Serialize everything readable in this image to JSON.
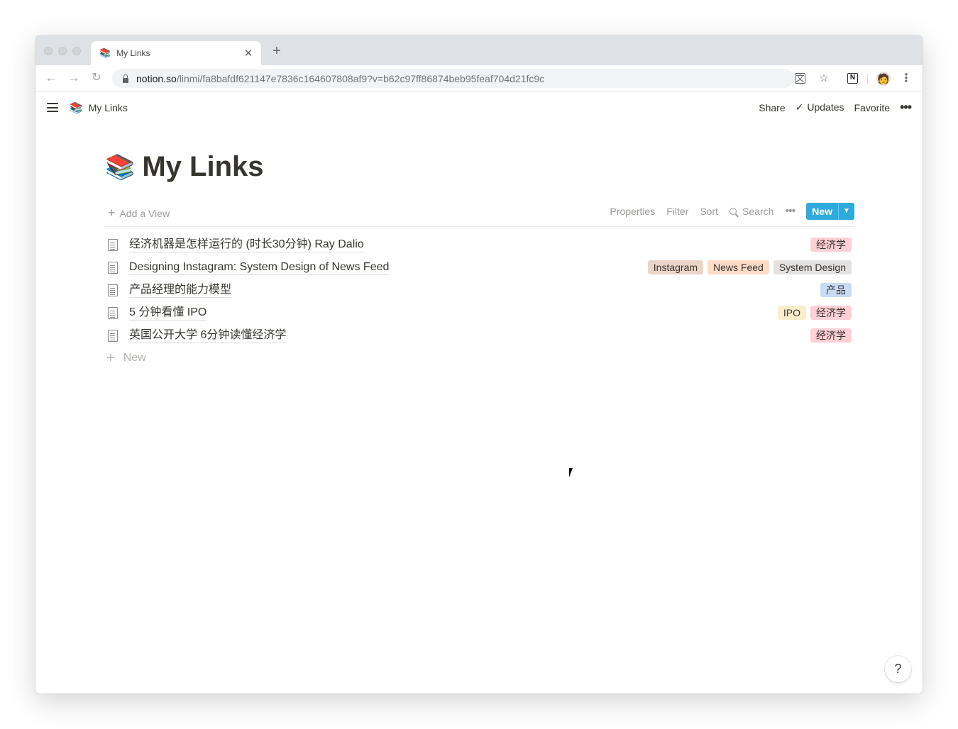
{
  "browser": {
    "tab_title": "My Links",
    "tab_icon": "books-emoji",
    "url_host": "notion.so",
    "url_path": "/linmi/fa8bafdf621147e7836c164607808af9?v=b62c97ff86874beb95feaf704d21fc9c"
  },
  "topbar": {
    "breadcrumb_emoji": "📚",
    "breadcrumb": "My Links",
    "share": "Share",
    "updates": "Updates",
    "favorite": "Favorite"
  },
  "page": {
    "emoji": "📚",
    "title": "My Links"
  },
  "viewbar": {
    "add_view": "Add a View",
    "properties": "Properties",
    "filter": "Filter",
    "sort": "Sort",
    "search": "Search",
    "new": "New"
  },
  "rows": [
    {
      "title": "经济机器是怎样运行的 (时长30分钟) Ray Dalio",
      "tags": [
        {
          "label": "经济学",
          "color": "#ffd0d6"
        }
      ]
    },
    {
      "title": "Designing Instagram: System Design of News Feed",
      "tags": [
        {
          "label": "Instagram",
          "color": "#ecd4c8"
        },
        {
          "label": "News Feed",
          "color": "#fddbc7"
        },
        {
          "label": "System Design",
          "color": "#e3e2e0"
        }
      ]
    },
    {
      "title": "产品经理的能力模型",
      "tags": [
        {
          "label": "产品",
          "color": "#c9dcf7"
        }
      ]
    },
    {
      "title": "5 分钟看懂 IPO",
      "tags": [
        {
          "label": "IPO",
          "color": "#fbeecb"
        },
        {
          "label": "经济学",
          "color": "#ffd0d6"
        }
      ]
    },
    {
      "title": "英国公开大学 6分钟读懂经济学",
      "tags": [
        {
          "label": "经济学",
          "color": "#ffd0d6"
        }
      ]
    }
  ],
  "new_row": "New",
  "help": "?"
}
